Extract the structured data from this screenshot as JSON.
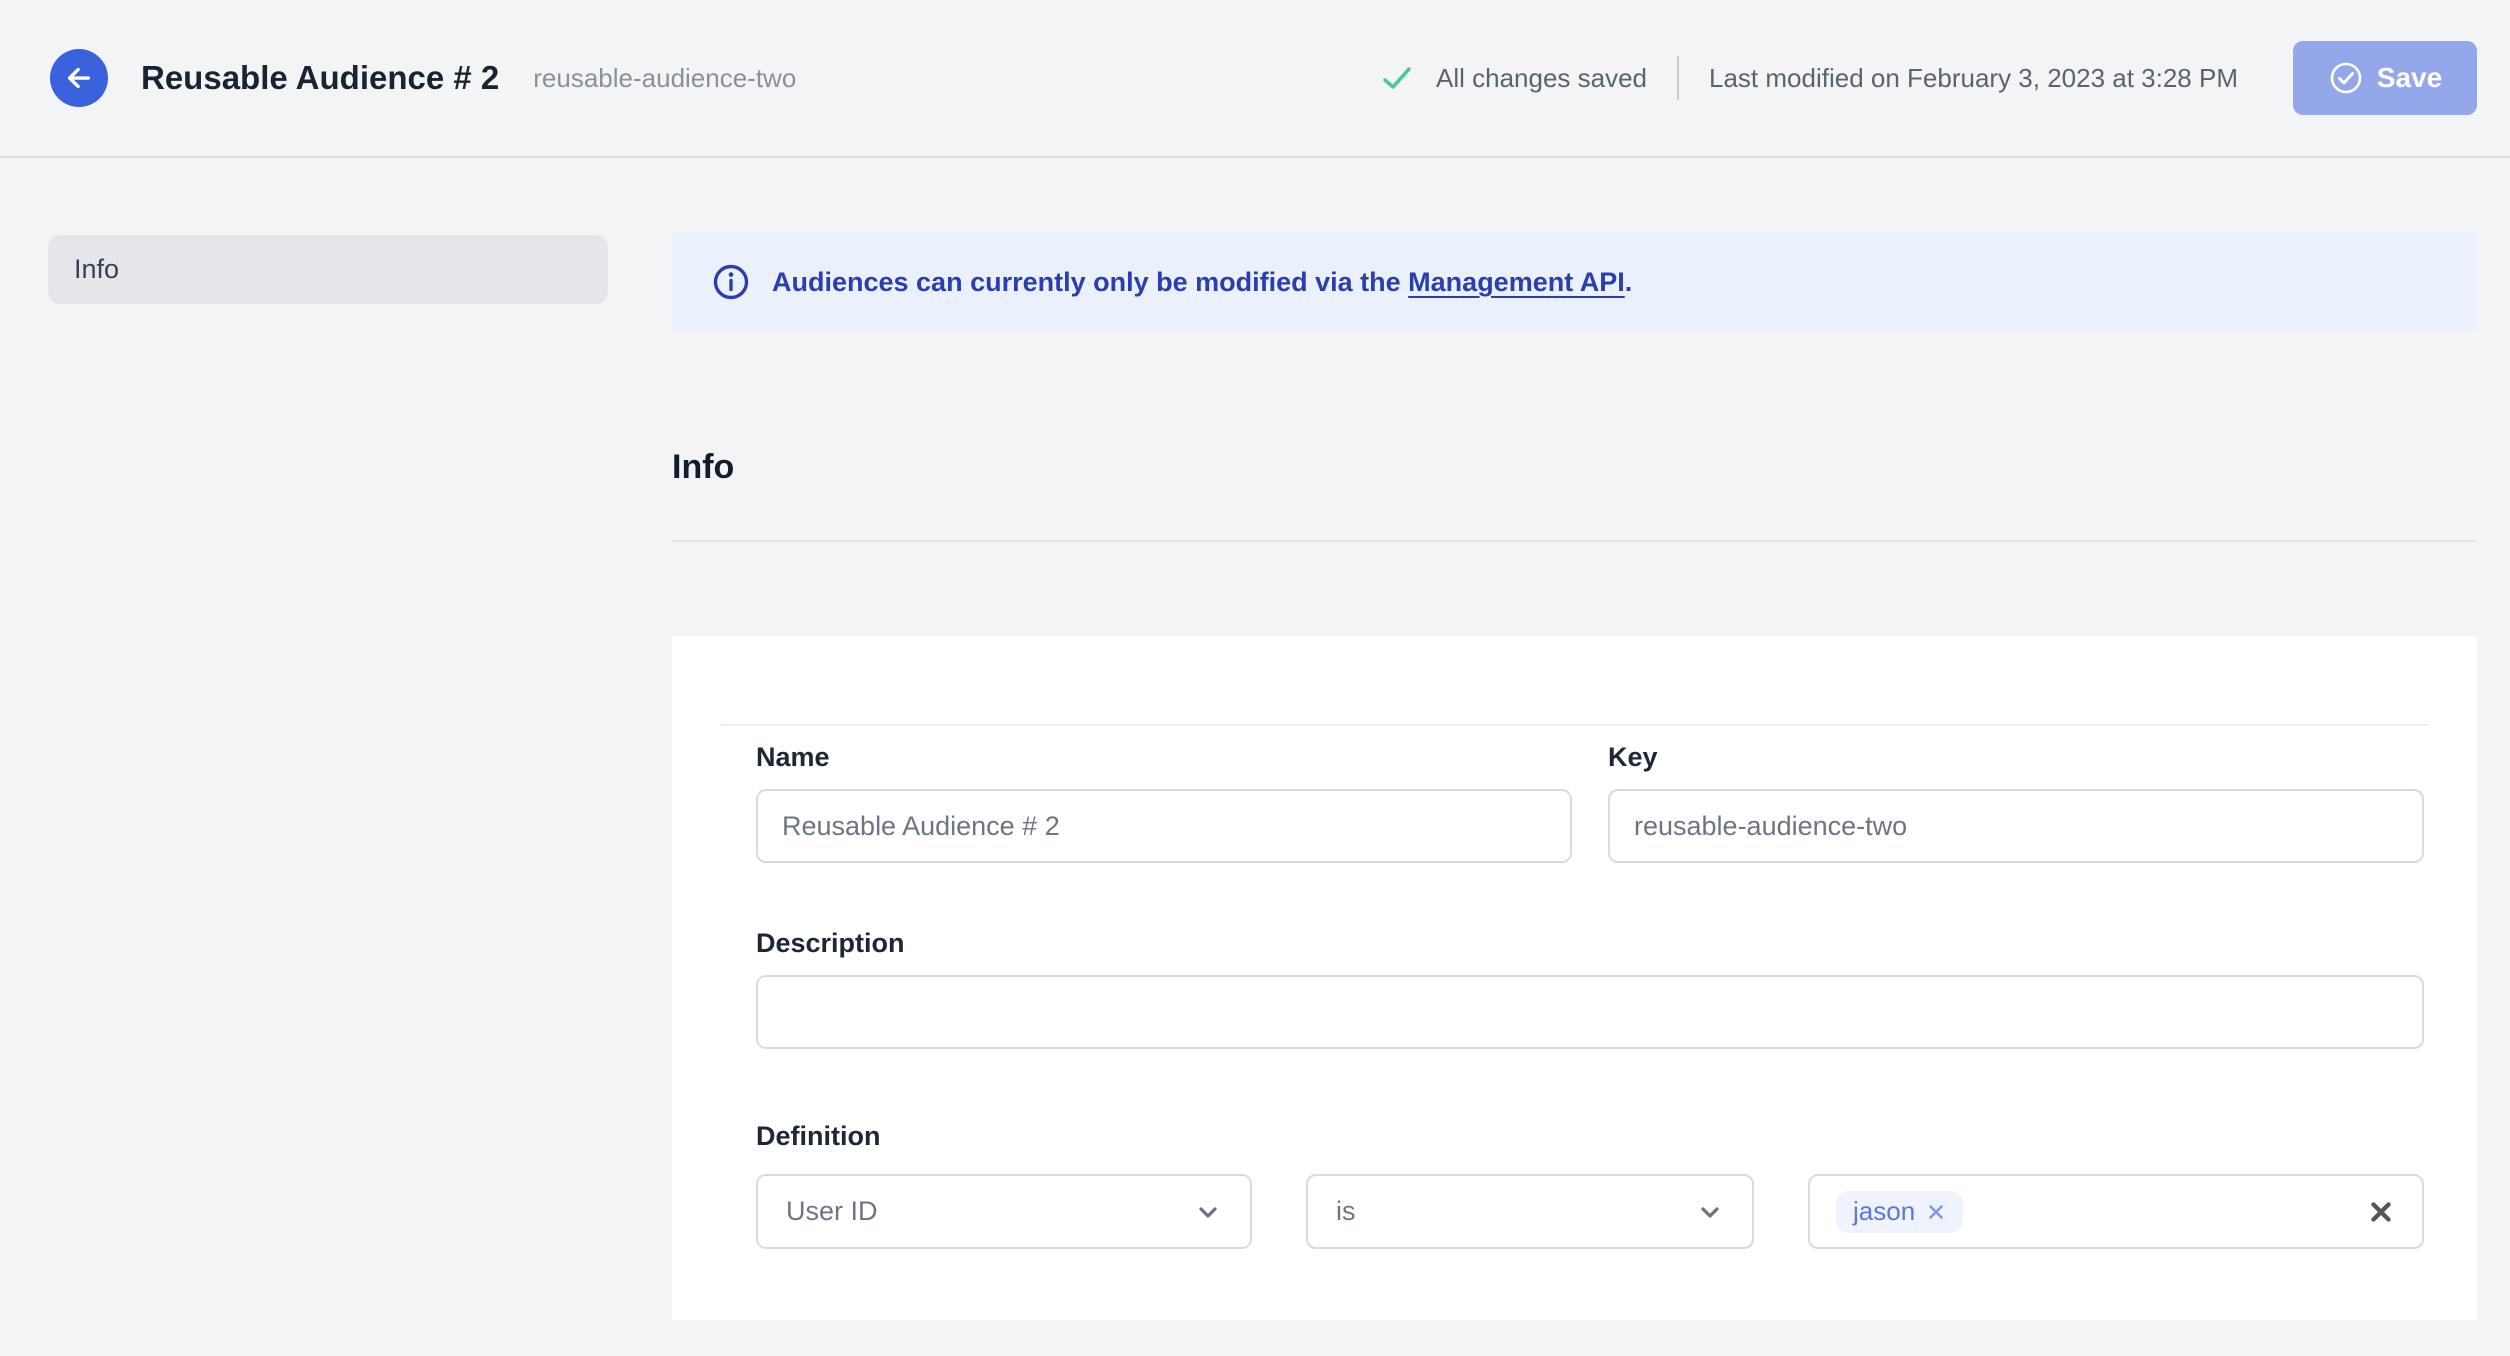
{
  "header": {
    "title": "Reusable Audience # 2",
    "slug": "reusable-audience-two",
    "saved_status": "All changes saved",
    "last_modified": "Last modified on February 3, 2023 at 3:28 PM",
    "save_label": "Save"
  },
  "sidebar": {
    "items": [
      {
        "label": "Info",
        "active": true
      }
    ]
  },
  "banner": {
    "text_before_link": "Audiences can currently only be modified via the ",
    "link_text": "Management API",
    "text_after_link": "."
  },
  "section": {
    "title": "Info"
  },
  "form": {
    "name": {
      "label": "Name",
      "value": "Reusable Audience # 2"
    },
    "key": {
      "label": "Key",
      "value": "reusable-audience-two"
    },
    "description": {
      "label": "Description",
      "value": ""
    },
    "definition": {
      "label": "Definition",
      "trait_selector": {
        "value": "User ID"
      },
      "operator_selector": {
        "value": "is"
      },
      "values": [
        "jason"
      ]
    }
  },
  "colors": {
    "accent_blue": "#3A62DC",
    "banner_text_blue": "#2A3EB1",
    "banner_bg": "#EAF1FC",
    "success_green": "#4EC7A6",
    "save_button_bg": "#95A7EB",
    "chip_bg": "#EEF3FD",
    "chip_text": "#5B76E5",
    "page_bg": "#F3F4F6"
  }
}
